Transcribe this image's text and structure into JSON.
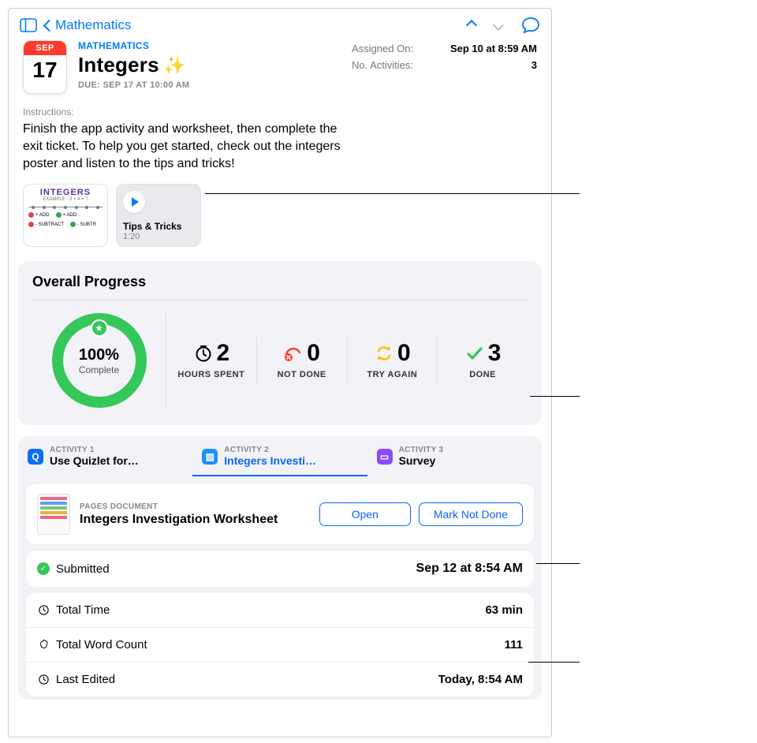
{
  "nav": {
    "back_label": "Mathematics"
  },
  "calendar": {
    "month": "SEP",
    "day": "17"
  },
  "header": {
    "subject": "MATHEMATICS",
    "title": "Integers",
    "due": "DUE: SEP 17 AT 10:00 AM"
  },
  "meta": {
    "assigned_label": "Assigned On:",
    "assigned_value": "Sep 10 at 8:59 AM",
    "activities_label": "No. Activities:",
    "activities_value": "3"
  },
  "instructions": {
    "label": "Instructions:",
    "text": "Finish the app activity and worksheet, then complete the exit ticket. To help you get started, check out the integers poster and listen to the tips and tricks!"
  },
  "attachments": {
    "poster_title": "INTEGERS",
    "audio": {
      "title": "Tips & Tricks",
      "duration": "1:20"
    }
  },
  "progress": {
    "title": "Overall Progress",
    "percent": "100%",
    "percent_sub": "Complete",
    "stats": {
      "hours_value": "2",
      "hours_label": "HOURS SPENT",
      "notdone_value": "0",
      "notdone_label": "NOT DONE",
      "tryagain_value": "0",
      "tryagain_label": "TRY AGAIN",
      "done_value": "3",
      "done_label": "DONE"
    }
  },
  "tabs": [
    {
      "idx": "ACTIVITY 1",
      "name": "Use Quizlet for…"
    },
    {
      "idx": "ACTIVITY 2",
      "name": "Integers Investi…"
    },
    {
      "idx": "ACTIVITY 3",
      "name": "Survey"
    }
  ],
  "activity_detail": {
    "kicker": "PAGES DOCUMENT",
    "title": "Integers Investigation Worksheet",
    "open": "Open",
    "mark": "Mark Not Done"
  },
  "submitted": {
    "label": "Submitted",
    "value": "Sep 12 at 8:54 AM"
  },
  "details": {
    "total_time_label": "Total Time",
    "total_time_value": "63 min",
    "word_count_label": "Total Word Count",
    "word_count_value": "111",
    "last_edited_label": "Last Edited",
    "last_edited_value": "Today, 8:54 AM"
  }
}
